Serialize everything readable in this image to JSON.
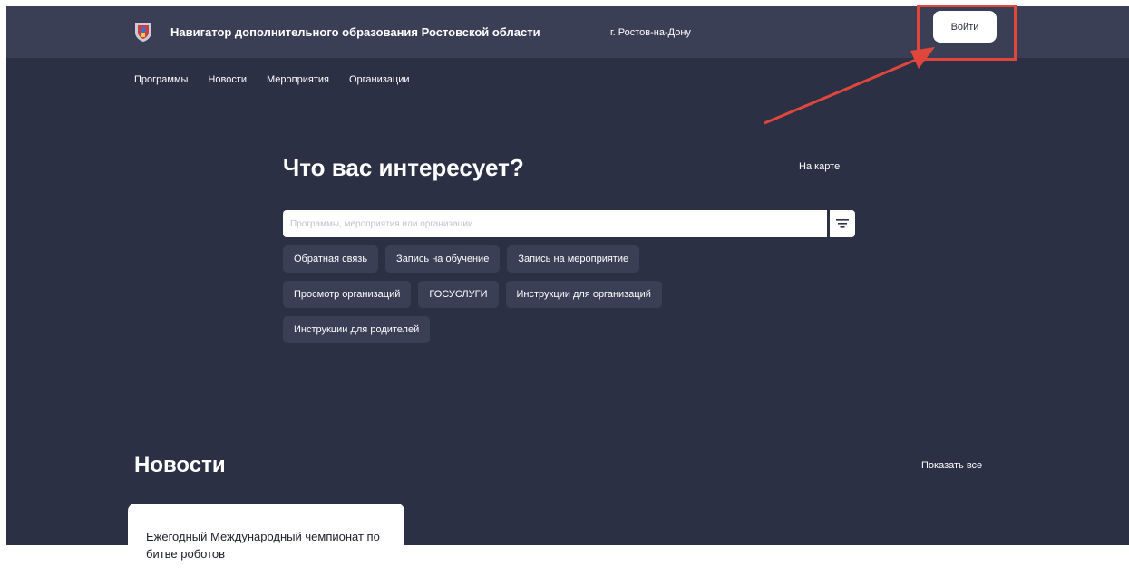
{
  "header": {
    "title": "Навигатор дополнительного образования Ростовской области",
    "city": "г. Ростов-на-Дону",
    "login_label": "Войти"
  },
  "nav": {
    "items": [
      "Программы",
      "Новости",
      "Мероприятия",
      "Организации"
    ]
  },
  "search": {
    "heading": "Что вас интересует?",
    "map_link": "На карте",
    "placeholder": "Программы, мероприятия или организации"
  },
  "chips": {
    "rows": [
      [
        "Обратная связь",
        "Запись на обучение",
        "Запись на мероприятие"
      ],
      [
        "Просмотр организаций",
        "ГОСУСЛУГИ",
        "Инструкции для организаций"
      ],
      [
        "Инструкции для родителей"
      ]
    ]
  },
  "news": {
    "heading": "Новости",
    "show_all": "Показать все",
    "cards": [
      {
        "title": "Ежегодный Международный чемпионат по битве роботов"
      }
    ]
  },
  "colors": {
    "background": "#2c3045",
    "topbar": "#3a3f55",
    "chip": "#3a3f55",
    "annotation": "#e0463c"
  },
  "icons": {
    "logo": "coat-of-arms-icon",
    "filter": "filter-icon",
    "annotation": "annotation-arrow"
  }
}
